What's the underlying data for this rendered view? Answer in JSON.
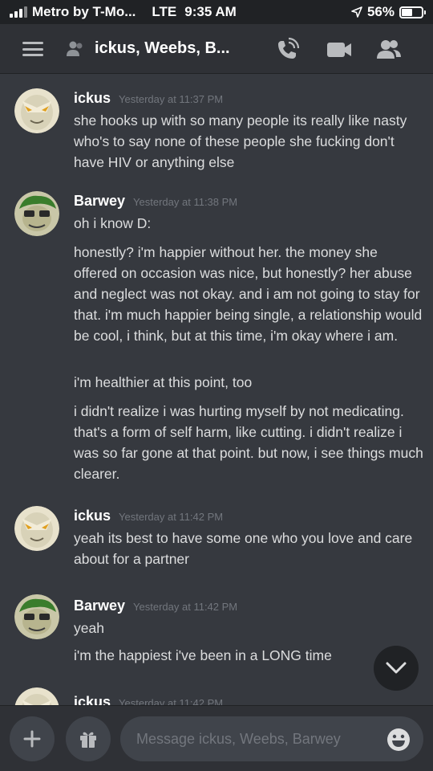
{
  "status_bar": {
    "carrier": "Metro by T-Mo...",
    "network": "LTE",
    "time": "9:35 AM",
    "battery_percent": "56%",
    "battery_level": 0.56,
    "icons": [
      "signal-icon",
      "location-arrow-icon",
      "battery-icon"
    ]
  },
  "header": {
    "title": "ickus, Weebs, B...",
    "icons": [
      "menu-icon",
      "group-dm-icon",
      "voice-call-icon",
      "video-call-icon",
      "members-icon"
    ]
  },
  "messages": [
    {
      "author": "ickus",
      "timestamp": "Yesterday at 11:37 PM",
      "lines": [
        "she hooks up with so many people  its really like nasty who's to say none of these people she fucking don't have HIV or anything else"
      ]
    },
    {
      "author": "Barwey",
      "timestamp": "Yesterday at 11:38 PM",
      "lines": [
        "oh i know D:",
        "honestly? i'm happier without her. the money she offered on occasion was nice, but honestly? her abuse and neglect was not okay. and i am not going to stay for that. i'm much happier being single, a relationship would be cool, i think, but at this time, i'm okay where i am.",
        "i'm healthier at this point, too",
        "i didn't realize i was hurting myself by not medicating. that's a form of self harm, like cutting. i didn't realize i was so far gone at that point. but now, i see things much clearer."
      ]
    },
    {
      "author": "ickus",
      "timestamp": "Yesterday at 11:42 PM",
      "lines": [
        "yeah its best to have some one who you love and care about for a partner"
      ]
    },
    {
      "author": "Barwey",
      "timestamp": "Yesterday at 11:42 PM",
      "lines": [
        "yeah",
        "i'm the happiest i've been in a LONG time"
      ]
    },
    {
      "author": "ickus",
      "timestamp": "Yesterday at 11:42 PM",
      "lines": []
    }
  ],
  "composer": {
    "placeholder": "Message ickus, Weebs, Barwey",
    "icons": [
      "plus-icon",
      "gift-icon",
      "emoji-icon",
      "chevron-down-icon"
    ]
  },
  "colors": {
    "background": "#36393f",
    "header": "#2f3136",
    "status_bar": "#202225",
    "input": "#40444b",
    "text": "#dcddde",
    "muted": "#72767d"
  }
}
